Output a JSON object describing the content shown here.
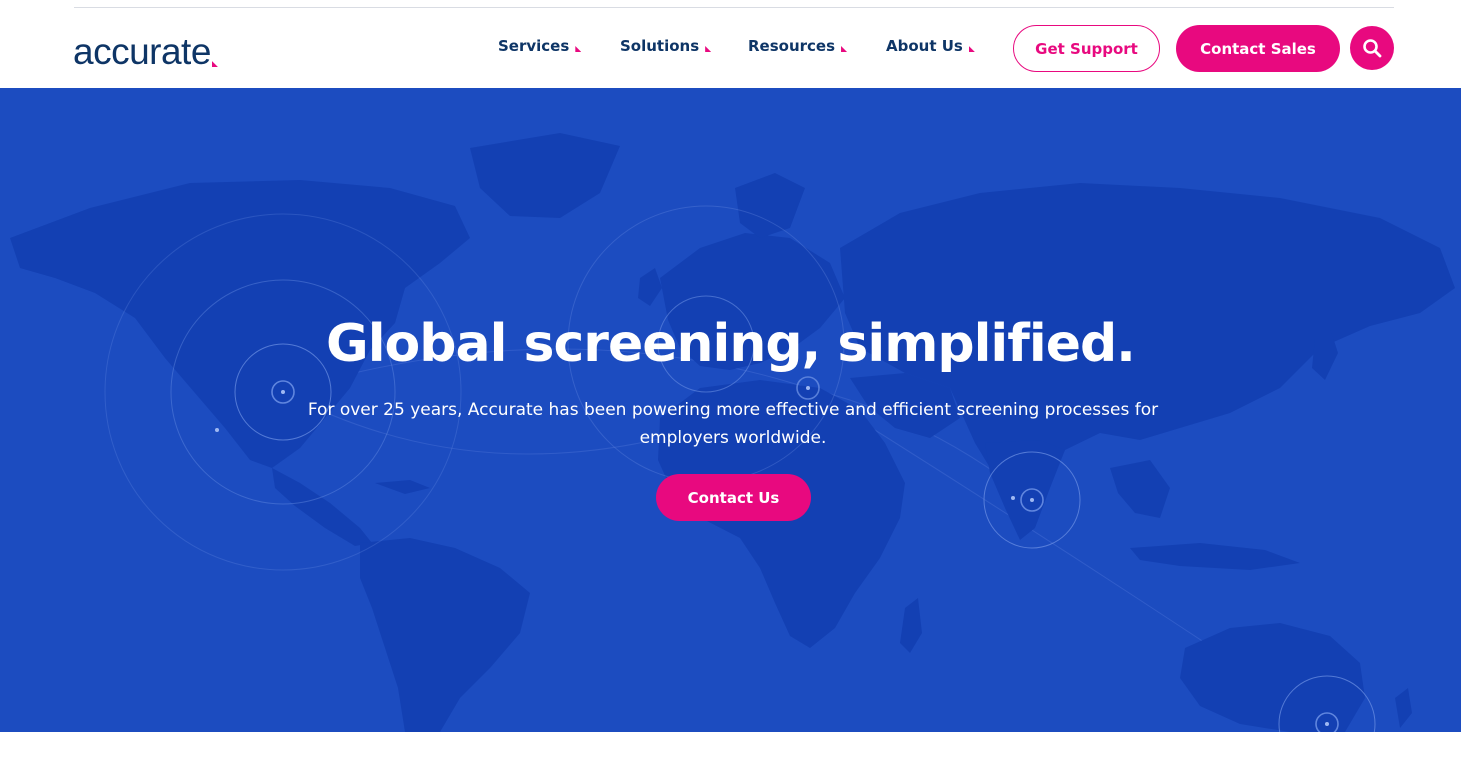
{
  "header": {
    "logo_text": "accurate",
    "nav": [
      {
        "label": "Services"
      },
      {
        "label": "Solutions"
      },
      {
        "label": "Resources"
      },
      {
        "label": "About Us"
      }
    ],
    "get_support_label": "Get Support",
    "contact_sales_label": "Contact Sales",
    "search_icon": "search-icon"
  },
  "hero": {
    "title": "Global screening, simplified.",
    "subtitle": "For over 25 years, Accurate has been powering more effective and efficient screening processes for employers worldwide.",
    "cta_label": "Contact Us"
  },
  "colors": {
    "brand_navy": "#0e3566",
    "brand_pink": "#e8097f",
    "hero_blue": "#1c4cc0",
    "land_blue": "#1340b3"
  }
}
